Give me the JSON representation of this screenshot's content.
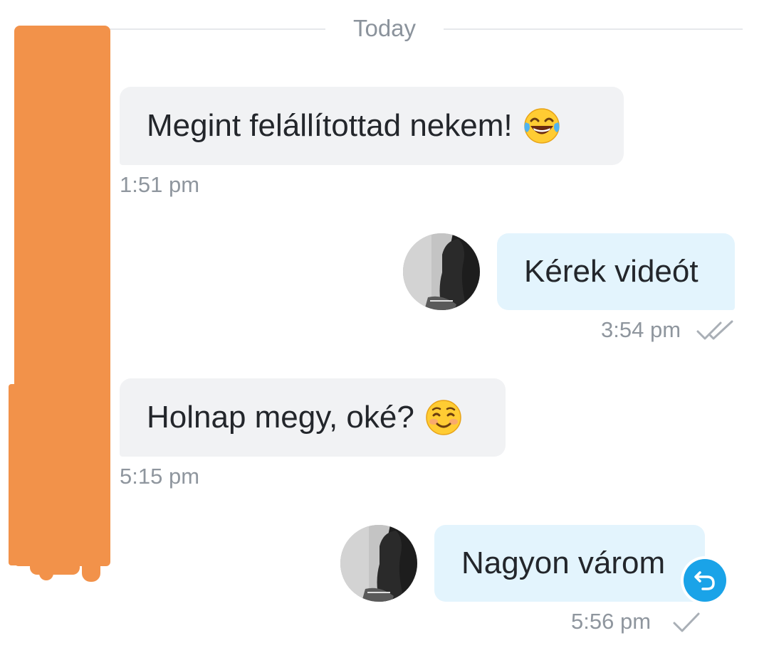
{
  "date_divider": {
    "label": "Today"
  },
  "messages": [
    {
      "direction": "incoming",
      "text": "Megint felállítottad nekem!",
      "emoji": "face-with-tears-of-joy",
      "time": "1:51 pm"
    },
    {
      "direction": "outgoing",
      "text": "Kérek videót",
      "time": "3:54 pm",
      "status": "read-double-check"
    },
    {
      "direction": "incoming",
      "text": "Holnap megy, oké?",
      "emoji": "smiling-face",
      "time": "5:15 pm"
    },
    {
      "direction": "outgoing",
      "text": "Nagyon várom",
      "time": "5:56 pm",
      "status": "sent-single-check",
      "reply_icon": "reply-arrow-icon"
    }
  ],
  "colors": {
    "incoming_bubble": "#f1f2f4",
    "outgoing_bubble": "#e3f4fd",
    "timestamp": "#8f969e",
    "reply_button": "#1aa3e8",
    "redaction": "#f2924a"
  }
}
